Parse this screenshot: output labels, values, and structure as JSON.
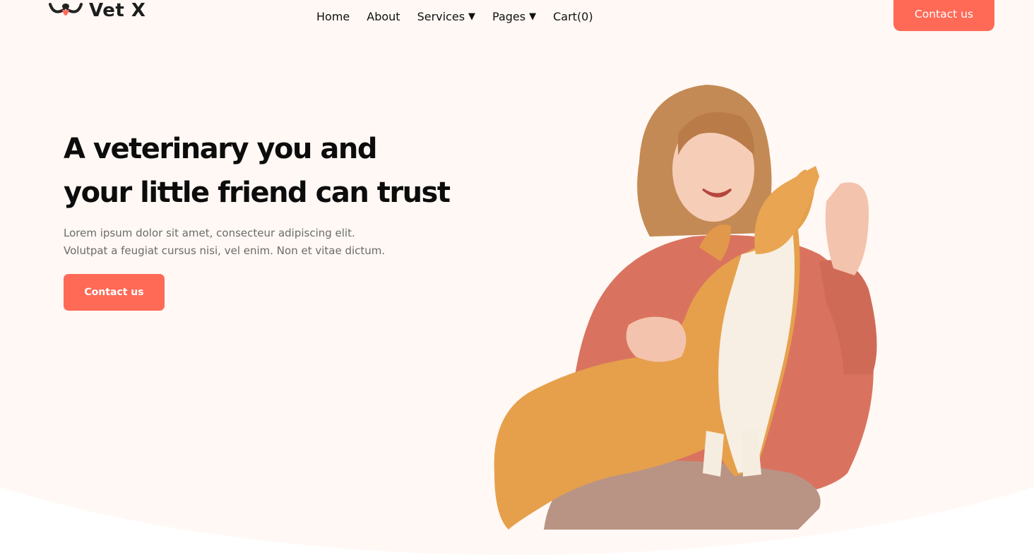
{
  "brand": {
    "name": "Vet X",
    "logo_icon": "dog-face-icon"
  },
  "nav": {
    "items": [
      {
        "label": "Home"
      },
      {
        "label": "About"
      },
      {
        "label": "Services",
        "caret": "▼"
      },
      {
        "label": "Pages",
        "caret": "▼"
      },
      {
        "label": "Cart(0)"
      }
    ]
  },
  "header": {
    "contact_label": "Contact us"
  },
  "hero": {
    "title_line1": "A veterinary you and",
    "title_line2": "your little friend can trust",
    "subtitle_line1": "Lorem ipsum dolor sit amet, consecteur adipiscing elit.",
    "subtitle_line2": "Volutpat a feugiat cursus nisi, vel enim. Non et vitae dictum.",
    "cta_label": "Contact us",
    "image": "woman-with-corgi-photo"
  },
  "colors": {
    "accent": "#ff6a57",
    "hero_background": "#fff8f4",
    "text_dark": "#0c0c0c",
    "text_muted": "#6b6b6b"
  }
}
